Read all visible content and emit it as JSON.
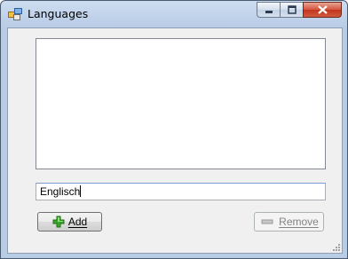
{
  "window": {
    "title": "Languages",
    "icons": {
      "app": "app-window-icon",
      "minimize": "minimize-icon",
      "maximize": "maximize-icon",
      "close": "close-icon"
    }
  },
  "languages": {
    "items": []
  },
  "input": {
    "value": "Englisch"
  },
  "buttons": {
    "add": {
      "label": "Add",
      "mnemonic": "A",
      "icon": "plus-icon",
      "enabled": true
    },
    "remove": {
      "label": "Remove",
      "mnemonic": "R",
      "icon": "minus-icon",
      "enabled": false
    }
  },
  "colors": {
    "add_icon": "#3aa52a",
    "close_button": "#c2351d",
    "disabled_text": "#838383"
  }
}
